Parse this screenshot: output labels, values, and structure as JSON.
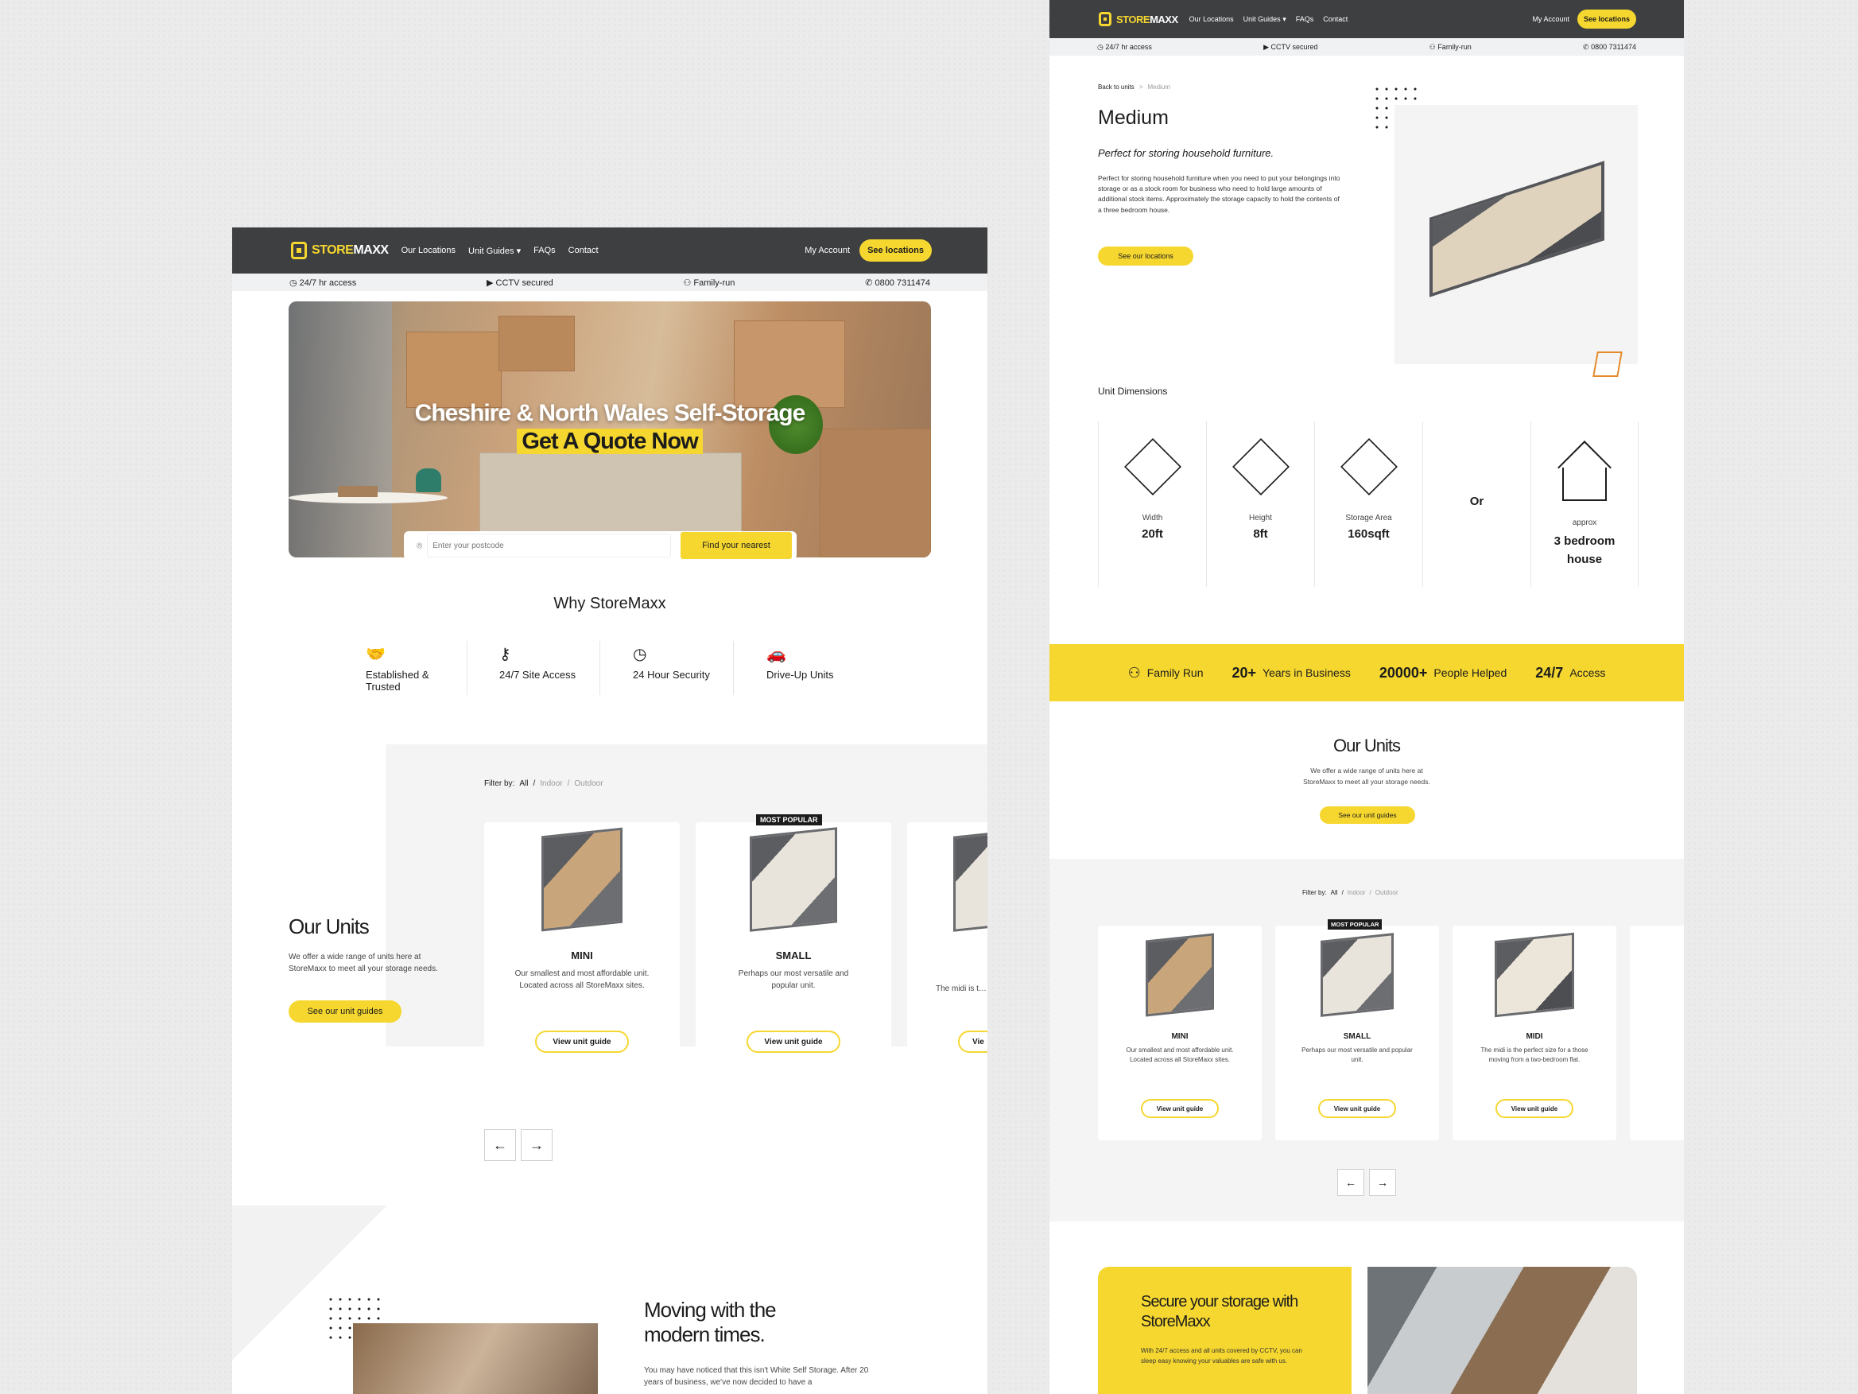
{
  "brand": {
    "word1": "STORE",
    "word2": "MAXX"
  },
  "nav": {
    "links": [
      "Our Locations",
      "Unit Guides",
      "FAQs",
      "Contact"
    ],
    "account": "My Account",
    "cta": "See locations"
  },
  "strip": {
    "access": "24/7 hr access",
    "cctv": "CCTV secured",
    "family": "Family-run",
    "phone": "0800 7311474"
  },
  "hero": {
    "title": "Cheshire & North Wales Self-Storage",
    "highlight": "Get A Quote Now",
    "placeholder": "Enter your postcode",
    "button": "Find your nearest"
  },
  "why": {
    "title": "Why StoreMaxx",
    "items": [
      {
        "label": "Established & Trusted",
        "icon": "handshake-icon"
      },
      {
        "label": "24/7 Site Access",
        "icon": "key-icon"
      },
      {
        "label": "24 Hour Security",
        "icon": "clock-icon"
      },
      {
        "label": "Drive-Up Units",
        "icon": "car-icon"
      }
    ]
  },
  "units": {
    "title": "Our Units",
    "desc": "We offer a wide range of units here at StoreMaxx to meet all your storage needs.",
    "cta": "See our unit guides",
    "filter_label": "Filter by:",
    "filters": [
      "All",
      "Indoor",
      "Outdoor"
    ],
    "badge": "MOST POPULAR",
    "view": "View unit guide",
    "cards": [
      {
        "name": "MINI",
        "desc": "Our smallest and most affordable unit. Located across all StoreMaxx sites."
      },
      {
        "name": "SMALL",
        "desc": "Perhaps our most versatile and popular unit."
      },
      {
        "name": "MIDI",
        "desc": "The midi is the perfect size for a those moving from a two-bedroom flat."
      }
    ],
    "partial_desc": "The midi is t… those moving",
    "partial_view": "Vie"
  },
  "moving": {
    "title": "Moving with the modern times.",
    "body": "You may have noticed that this isn't White Self Storage. After 20 years of business, we've now decided to have a"
  },
  "detail": {
    "breadcrumb_back": "Back to units",
    "breadcrumb_sep": ">",
    "breadcrumb_current": "Medium",
    "title": "Medium",
    "subtitle": "Perfect for storing household furniture.",
    "body": "Perfect for storing household furniture when you need to put your belongings into storage or as a stock room for business who need to hold large amounts of additional stock items. Approximately the storage capacity to hold the contents of a three bedroom house.",
    "cta": "See our locations"
  },
  "dims": {
    "title": "Unit Dimensions",
    "items": [
      {
        "label": "Width",
        "value": "20ft"
      },
      {
        "label": "Height",
        "value": "8ft"
      },
      {
        "label": "Storage Area",
        "value": "160sqft"
      }
    ],
    "or": "Or",
    "house_label": "approx",
    "house_value": "3 bedroom house"
  },
  "stats": [
    {
      "value": "",
      "label": "Family Run"
    },
    {
      "value": "20+",
      "label": "Years in Business"
    },
    {
      "value": "20000+",
      "label": "People Helped"
    },
    {
      "value": "24/7",
      "label": "Access"
    }
  ],
  "units2": {
    "title": "Our Units",
    "desc": "We offer a wide range of units here at StoreMaxx to meet all your storage needs."
  },
  "secure": {
    "title": "Secure your storage with StoreMaxx",
    "body": "With 24/7 access and all units covered by CCTV, you can sleep easy knowing your valuables are safe with us."
  },
  "colors": {
    "accent": "#f6d730",
    "nav": "#3d3f41",
    "orange": "#e58a2a"
  }
}
